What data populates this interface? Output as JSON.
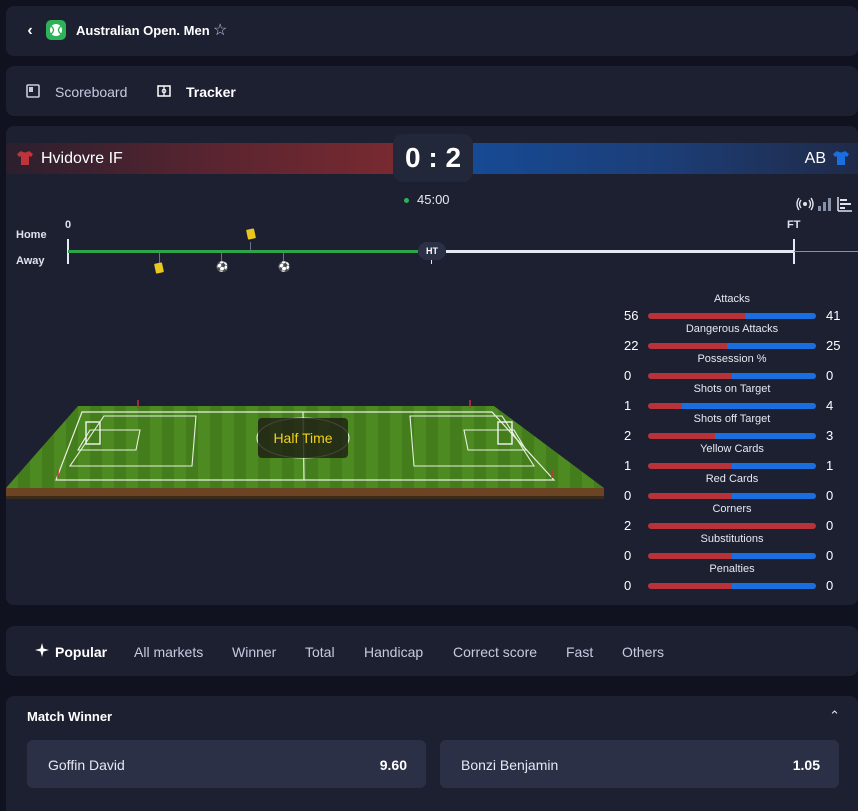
{
  "header": {
    "title": "Australian Open. Men",
    "back_icon": "chevron-left-icon",
    "sport_icon": "tennis-ball-icon",
    "favorite_icon": "star-outline-icon"
  },
  "view_tabs": [
    {
      "label": "Scoreboard",
      "icon": "scoreboard-icon",
      "active": false
    },
    {
      "label": "Tracker",
      "icon": "pitch-icon",
      "active": true
    }
  ],
  "tracker": {
    "home": {
      "name": "Hvidovre IF",
      "color": "#b8323a"
    },
    "away": {
      "name": "AB",
      "color": "#1a6fe0"
    },
    "score": "0 : 2",
    "time": "45:00",
    "status_label": "Half Time",
    "timeline": {
      "home_label": "Home",
      "away_label": "Away",
      "start_label": "0",
      "ht_label": "HT",
      "ft_label": "FT",
      "progress": 0.5,
      "events": [
        {
          "side": "home",
          "type": "yellow-card",
          "minute_fraction": 0.25
        },
        {
          "side": "away",
          "type": "yellow-card",
          "minute_fraction": 0.12
        },
        {
          "side": "away",
          "type": "goal",
          "minute_fraction": 0.21
        },
        {
          "side": "away",
          "type": "goal",
          "minute_fraction": 0.29
        }
      ]
    },
    "controls": [
      "broadcast-icon",
      "signal-bars-icon",
      "stats-icon"
    ]
  },
  "stats": [
    {
      "name": "Attacks",
      "home": "56",
      "away": "41"
    },
    {
      "name": "Dangerous Attacks",
      "home": "22",
      "away": "25"
    },
    {
      "name": "Possession %",
      "home": "0",
      "away": "0"
    },
    {
      "name": "Shots on Target",
      "home": "1",
      "away": "4"
    },
    {
      "name": "Shots off Target",
      "home": "2",
      "away": "3"
    },
    {
      "name": "Yellow Cards",
      "home": "1",
      "away": "1"
    },
    {
      "name": "Red Cards",
      "home": "0",
      "away": "0"
    },
    {
      "name": "Corners",
      "home": "2",
      "away": "0"
    },
    {
      "name": "Substitutions",
      "home": "0",
      "away": "0"
    },
    {
      "name": "Penalties",
      "home": "0",
      "away": "0"
    }
  ],
  "market_tabs": [
    {
      "label": "Popular",
      "icon": "sparkle-icon",
      "active": true
    },
    {
      "label": "All markets"
    },
    {
      "label": "Winner"
    },
    {
      "label": "Total"
    },
    {
      "label": "Handicap"
    },
    {
      "label": "Correct score"
    },
    {
      "label": "Fast"
    },
    {
      "label": "Others"
    }
  ],
  "match_winner": {
    "title": "Match Winner",
    "options": [
      {
        "name": "Goffin David",
        "odds": "9.60"
      },
      {
        "name": "Bonzi Benjamin",
        "odds": "1.05"
      }
    ]
  }
}
